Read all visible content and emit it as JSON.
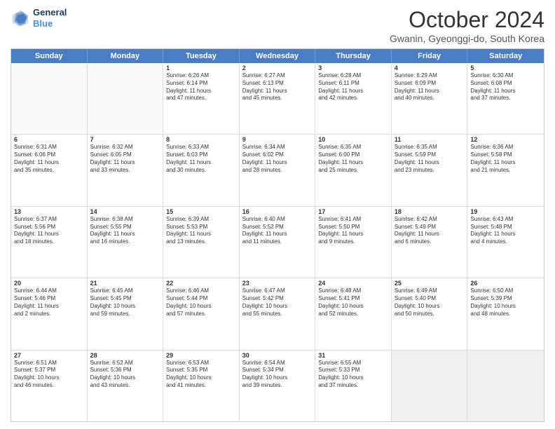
{
  "header": {
    "logo_line1": "General",
    "logo_line2": "Blue",
    "month_title": "October 2024",
    "subtitle": "Gwanin, Gyeonggi-do, South Korea"
  },
  "weekdays": [
    "Sunday",
    "Monday",
    "Tuesday",
    "Wednesday",
    "Thursday",
    "Friday",
    "Saturday"
  ],
  "rows": [
    [
      {
        "day": "",
        "empty": true
      },
      {
        "day": "",
        "empty": true
      },
      {
        "day": "1",
        "lines": [
          "Sunrise: 6:26 AM",
          "Sunset: 6:14 PM",
          "Daylight: 11 hours",
          "and 47 minutes."
        ]
      },
      {
        "day": "2",
        "lines": [
          "Sunrise: 6:27 AM",
          "Sunset: 6:13 PM",
          "Daylight: 11 hours",
          "and 45 minutes."
        ]
      },
      {
        "day": "3",
        "lines": [
          "Sunrise: 6:28 AM",
          "Sunset: 6:11 PM",
          "Daylight: 11 hours",
          "and 42 minutes."
        ]
      },
      {
        "day": "4",
        "lines": [
          "Sunrise: 6:29 AM",
          "Sunset: 6:09 PM",
          "Daylight: 11 hours",
          "and 40 minutes."
        ]
      },
      {
        "day": "5",
        "lines": [
          "Sunrise: 6:30 AM",
          "Sunset: 6:08 PM",
          "Daylight: 11 hours",
          "and 37 minutes."
        ]
      }
    ],
    [
      {
        "day": "6",
        "lines": [
          "Sunrise: 6:31 AM",
          "Sunset: 6:06 PM",
          "Daylight: 11 hours",
          "and 35 minutes."
        ]
      },
      {
        "day": "7",
        "lines": [
          "Sunrise: 6:32 AM",
          "Sunset: 6:05 PM",
          "Daylight: 11 hours",
          "and 33 minutes."
        ]
      },
      {
        "day": "8",
        "lines": [
          "Sunrise: 6:33 AM",
          "Sunset: 6:03 PM",
          "Daylight: 11 hours",
          "and 30 minutes."
        ]
      },
      {
        "day": "9",
        "lines": [
          "Sunrise: 6:34 AM",
          "Sunset: 6:02 PM",
          "Daylight: 11 hours",
          "and 28 minutes."
        ]
      },
      {
        "day": "10",
        "lines": [
          "Sunrise: 6:35 AM",
          "Sunset: 6:00 PM",
          "Daylight: 11 hours",
          "and 25 minutes."
        ]
      },
      {
        "day": "11",
        "lines": [
          "Sunrise: 6:35 AM",
          "Sunset: 5:59 PM",
          "Daylight: 11 hours",
          "and 23 minutes."
        ]
      },
      {
        "day": "12",
        "lines": [
          "Sunrise: 6:36 AM",
          "Sunset: 5:58 PM",
          "Daylight: 11 hours",
          "and 21 minutes."
        ]
      }
    ],
    [
      {
        "day": "13",
        "lines": [
          "Sunrise: 6:37 AM",
          "Sunset: 5:56 PM",
          "Daylight: 11 hours",
          "and 18 minutes."
        ]
      },
      {
        "day": "14",
        "lines": [
          "Sunrise: 6:38 AM",
          "Sunset: 5:55 PM",
          "Daylight: 11 hours",
          "and 16 minutes."
        ]
      },
      {
        "day": "15",
        "lines": [
          "Sunrise: 6:39 AM",
          "Sunset: 5:53 PM",
          "Daylight: 11 hours",
          "and 13 minutes."
        ]
      },
      {
        "day": "16",
        "lines": [
          "Sunrise: 6:40 AM",
          "Sunset: 5:52 PM",
          "Daylight: 11 hours",
          "and 11 minutes."
        ]
      },
      {
        "day": "17",
        "lines": [
          "Sunrise: 6:41 AM",
          "Sunset: 5:50 PM",
          "Daylight: 11 hours",
          "and 9 minutes."
        ]
      },
      {
        "day": "18",
        "lines": [
          "Sunrise: 6:42 AM",
          "Sunset: 5:49 PM",
          "Daylight: 11 hours",
          "and 6 minutes."
        ]
      },
      {
        "day": "19",
        "lines": [
          "Sunrise: 6:43 AM",
          "Sunset: 5:48 PM",
          "Daylight: 11 hours",
          "and 4 minutes."
        ]
      }
    ],
    [
      {
        "day": "20",
        "lines": [
          "Sunrise: 6:44 AM",
          "Sunset: 5:46 PM",
          "Daylight: 11 hours",
          "and 2 minutes."
        ]
      },
      {
        "day": "21",
        "lines": [
          "Sunrise: 6:45 AM",
          "Sunset: 5:45 PM",
          "Daylight: 10 hours",
          "and 59 minutes."
        ]
      },
      {
        "day": "22",
        "lines": [
          "Sunrise: 6:46 AM",
          "Sunset: 5:44 PM",
          "Daylight: 10 hours",
          "and 57 minutes."
        ]
      },
      {
        "day": "23",
        "lines": [
          "Sunrise: 6:47 AM",
          "Sunset: 5:42 PM",
          "Daylight: 10 hours",
          "and 55 minutes."
        ]
      },
      {
        "day": "24",
        "lines": [
          "Sunrise: 6:48 AM",
          "Sunset: 5:41 PM",
          "Daylight: 10 hours",
          "and 52 minutes."
        ]
      },
      {
        "day": "25",
        "lines": [
          "Sunrise: 6:49 AM",
          "Sunset: 5:40 PM",
          "Daylight: 10 hours",
          "and 50 minutes."
        ]
      },
      {
        "day": "26",
        "lines": [
          "Sunrise: 6:50 AM",
          "Sunset: 5:39 PM",
          "Daylight: 10 hours",
          "and 48 minutes."
        ]
      }
    ],
    [
      {
        "day": "27",
        "lines": [
          "Sunrise: 6:51 AM",
          "Sunset: 5:37 PM",
          "Daylight: 10 hours",
          "and 46 minutes."
        ]
      },
      {
        "day": "28",
        "lines": [
          "Sunrise: 6:52 AM",
          "Sunset: 5:36 PM",
          "Daylight: 10 hours",
          "and 43 minutes."
        ]
      },
      {
        "day": "29",
        "lines": [
          "Sunrise: 6:53 AM",
          "Sunset: 5:35 PM",
          "Daylight: 10 hours",
          "and 41 minutes."
        ]
      },
      {
        "day": "30",
        "lines": [
          "Sunrise: 6:54 AM",
          "Sunset: 5:34 PM",
          "Daylight: 10 hours",
          "and 39 minutes."
        ]
      },
      {
        "day": "31",
        "lines": [
          "Sunrise: 6:55 AM",
          "Sunset: 5:33 PM",
          "Daylight: 10 hours",
          "and 37 minutes."
        ]
      },
      {
        "day": "",
        "empty": true
      },
      {
        "day": "",
        "empty": true
      }
    ]
  ]
}
